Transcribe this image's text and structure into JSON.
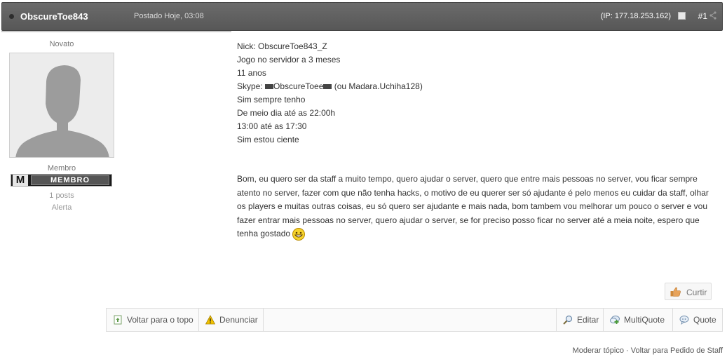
{
  "header": {
    "username": "ObscureToe843",
    "posted": "Postado Hoje, 03:08",
    "ip": "(IP: 177.18.253.162)",
    "post_number": "#1"
  },
  "author": {
    "rank_title": "Novato",
    "group": "Membro",
    "badge_letter": "M",
    "badge_text": "MEMBRO",
    "posts": "1 posts",
    "alert": "Alerta"
  },
  "post": {
    "lines": [
      "Nick: ObscureToe843_Z",
      "Jogo no servidor a 3 meses",
      "11 anos"
    ],
    "skype_prefix": "Skype: ",
    "skype_name": "ObscureToee",
    "skype_suffix": " (ou Madara.Uchiha128)",
    "lines_after": [
      "Sim sempre tenho",
      "De meio dia até as 22:00h",
      "13:00 até as 17:30",
      "Sim estou ciente"
    ],
    "paragraph": "Bom, eu quero ser da staff a muito tempo, quero ajudar o server, quero que entre mais pessoas no server, vou ficar sempre atento no server, fazer com que não tenha hacks, o motivo de eu querer ser só ajudante é pelo menos eu cuidar da staff, olhar os players e muitas outras coisas, eu só quero ser ajudante e mais nada, bom tambem vou melhorar um pouco o server e vou fazer entrar mais pessoas no server, quero ajudar o server, se for preciso posso ficar no server até a meia noite, espero que tenha gostado "
  },
  "like_label": "Curtir",
  "actions": {
    "back_to_top": "Voltar para o topo",
    "report": "Denunciar",
    "edit": "Editar",
    "multiquote": "MultiQuote",
    "quote": "Quote"
  },
  "footer": {
    "moderate": "Moderar tópico",
    "separator": " · ",
    "back_link": "Voltar para Pedido de Staff"
  },
  "icons": {
    "header_dot": "status-dot-icon",
    "share": "share-icon",
    "like": "thumbs-up-icon",
    "back_to_top": "page-up-icon",
    "report": "warning-icon",
    "edit": "magnifier-edit-icon",
    "multiquote": "multiquote-icon",
    "quote": "quote-bubble-icon",
    "smiley": "grin-smiley-icon"
  },
  "colors": {
    "header_bg": "#5f5f5f",
    "warning": "#f2c200",
    "like_hand": "#e8a35a"
  }
}
